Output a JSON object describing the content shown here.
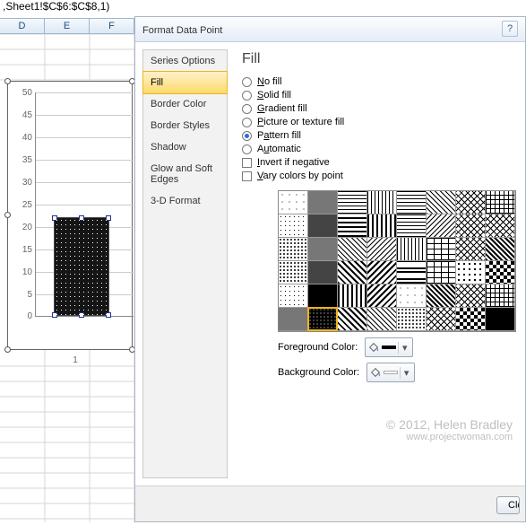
{
  "formula": ",Sheet1!$C$6:$C$8,1)",
  "columns": [
    "D",
    "E",
    "F"
  ],
  "chart_data": {
    "type": "bar",
    "categories": [
      "1"
    ],
    "values": [
      22
    ],
    "title": "",
    "xlabel": "",
    "ylabel": "",
    "ylim": [
      0,
      50
    ],
    "yticks": [
      0,
      5,
      10,
      15,
      20,
      25,
      30,
      35,
      40,
      45,
      50
    ]
  },
  "dialog": {
    "title": "Format Data Point",
    "help": "?",
    "nav": {
      "items": [
        "Series Options",
        "Fill",
        "Border Color",
        "Border Styles",
        "Shadow",
        "Glow and Soft Edges",
        "3-D Format"
      ],
      "selected": "Fill"
    },
    "pane_title": "Fill",
    "options": {
      "no_fill": "No fill",
      "solid_fill": "Solid fill",
      "gradient_fill": "Gradient fill",
      "picture_fill": "Picture or texture fill",
      "pattern_fill": "Pattern fill",
      "automatic": "Automatic",
      "invert": "Invert if negative",
      "vary": "Vary colors by point",
      "selected": "pattern_fill"
    },
    "fg_label": "Foreground Color:",
    "bg_label": "Background Color:",
    "fg_color": "#000000",
    "bg_color": "#ffffff",
    "close_btn": "Close"
  },
  "watermark": {
    "line1": "© 2012, Helen Bradley",
    "line2": "www.projectwoman.com"
  }
}
